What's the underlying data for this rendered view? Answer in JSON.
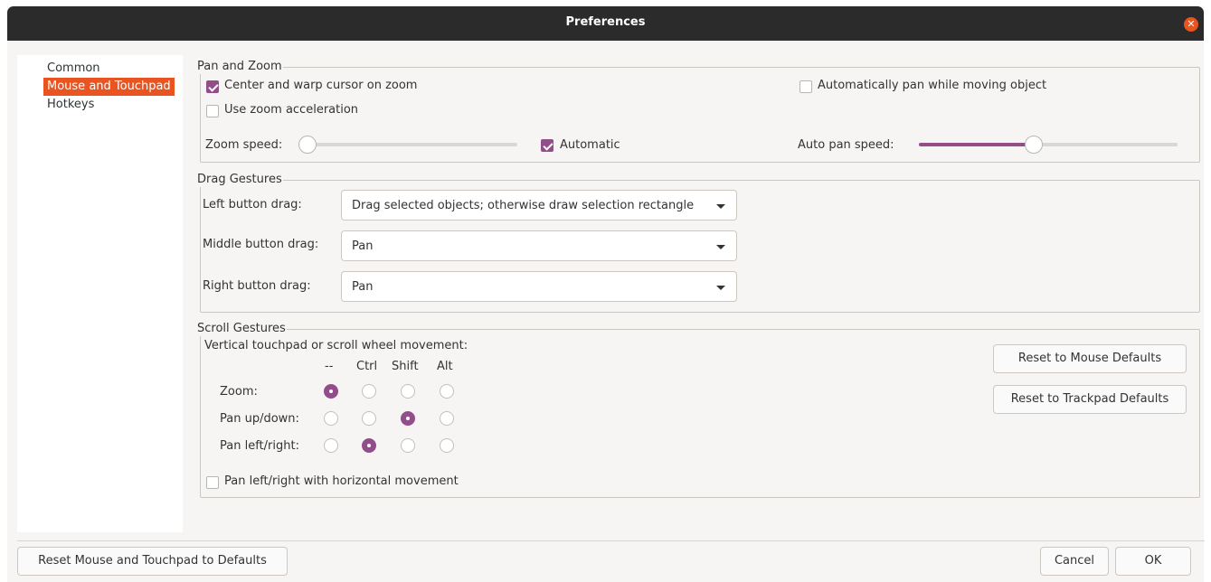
{
  "window": {
    "title": "Preferences"
  },
  "sidebar": {
    "items": [
      {
        "label": "Common",
        "selected": false
      },
      {
        "label": "Mouse and Touchpad",
        "selected": true
      },
      {
        "label": "Hotkeys",
        "selected": false
      }
    ]
  },
  "pan_zoom": {
    "title": "Pan and Zoom",
    "center_warp": {
      "label": "Center and warp cursor on zoom",
      "checked": true
    },
    "zoom_accel": {
      "label": "Use zoom acceleration",
      "checked": false
    },
    "auto_pan": {
      "label": "Automatically pan while moving object",
      "checked": false
    },
    "zoom_speed": {
      "label": "Zoom speed:",
      "value_fraction": 0.0
    },
    "automatic": {
      "label": "Automatic",
      "checked": true
    },
    "auto_pan_speed": {
      "label": "Auto pan speed:",
      "value_fraction": 0.44
    }
  },
  "drag": {
    "title": "Drag Gestures",
    "left": {
      "label": "Left button drag:",
      "value": "Drag selected objects; otherwise draw selection rectangle"
    },
    "middle": {
      "label": "Middle button drag:",
      "value": "Pan"
    },
    "right": {
      "label": "Right button drag:",
      "value": "Pan"
    }
  },
  "scroll": {
    "title": "Scroll Gestures",
    "subtitle": "Vertical touchpad or scroll wheel movement:",
    "columns": [
      "--",
      "Ctrl",
      "Shift",
      "Alt"
    ],
    "rows": [
      {
        "label": "Zoom:",
        "selected_col": 0
      },
      {
        "label": "Pan up/down:",
        "selected_col": 2
      },
      {
        "label": "Pan left/right:",
        "selected_col": 1
      }
    ],
    "horizontal": {
      "label": "Pan left/right with horizontal movement",
      "checked": false
    },
    "reset_mouse": "Reset to Mouse Defaults",
    "reset_trackpad": "Reset to Trackpad Defaults"
  },
  "footer": {
    "reset_all": "Reset Mouse and Touchpad to Defaults",
    "cancel": "Cancel",
    "ok": "OK"
  },
  "colors": {
    "accent": "#924d8b",
    "selection": "#e95420",
    "titlebar": "#2b2b2b"
  },
  "icons": {
    "close": "close-icon",
    "dropdown": "chevron-down-icon",
    "check": "checkmark-icon"
  }
}
